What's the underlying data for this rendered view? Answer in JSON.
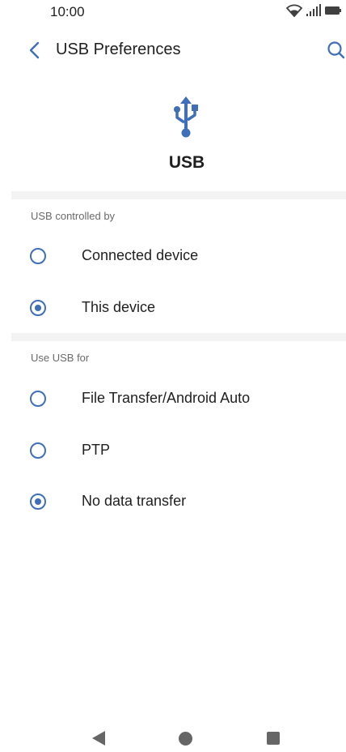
{
  "status_bar": {
    "time": "10:00",
    "icons": [
      "wifi-icon",
      "signal-icon",
      "battery-icon"
    ]
  },
  "app_bar": {
    "title": "USB Preferences",
    "back_icon": "back-arrow-icon",
    "search_icon": "search-icon"
  },
  "header": {
    "icon": "usb-icon",
    "label": "USB"
  },
  "sections": [
    {
      "title": "USB controlled by",
      "options": [
        {
          "label": "Connected device",
          "checked": false
        },
        {
          "label": "This device",
          "checked": true
        }
      ]
    },
    {
      "title": "Use USB for",
      "options": [
        {
          "label": "File Transfer/Android Auto",
          "checked": false
        },
        {
          "label": "PTP",
          "checked": false
        },
        {
          "label": "No data transfer",
          "checked": true
        }
      ]
    }
  ],
  "nav_bar": {
    "icons": [
      "nav-back-icon",
      "nav-home-icon",
      "nav-recents-icon"
    ]
  },
  "colors": {
    "accent": "#3f6fb8",
    "divider": "#f3f3f3",
    "nav_icon": "#666666"
  }
}
